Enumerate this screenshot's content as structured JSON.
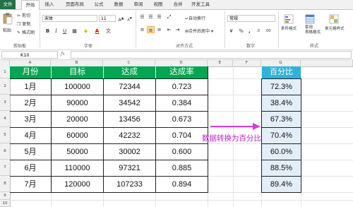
{
  "tabs": [
    "文件",
    "开始",
    "插入",
    "页面布局",
    "公式",
    "数据",
    "审阅",
    "视图",
    "合并",
    "开发工具"
  ],
  "clipboard": {
    "paste": "粘贴",
    "cut": "剪切",
    "copy": "复制",
    "format_painter": "格式刷",
    "label": "剪贴板"
  },
  "font": {
    "name": "宋体",
    "size": "11",
    "label": "字体"
  },
  "alignment": {
    "wrap": "自动换行",
    "merge": "合并后居中",
    "label": "对齐方式"
  },
  "number": {
    "format": "常规",
    "label": "数字",
    "percent": "%",
    "comma": ","
  },
  "styles": {
    "conditional": "条件格式",
    "table": "套用\n表格格式",
    "cell": "单元格样式",
    "label": "样式"
  },
  "namebox": "K10",
  "fx": "fx",
  "columns": [
    "A",
    "B",
    "C",
    "D",
    "E",
    "F",
    "G"
  ],
  "rows": [
    "1",
    "2",
    "3",
    "4",
    "5",
    "6",
    "7",
    "8",
    "9",
    "10"
  ],
  "table_header": [
    "月份",
    "目标",
    "达成",
    "达成率"
  ],
  "table_rows": [
    [
      "1月",
      "100000",
      "72344",
      "0.723"
    ],
    [
      "2月",
      "90000",
      "34542",
      "0.384"
    ],
    [
      "3月",
      "20000",
      "13456",
      "0.673"
    ],
    [
      "4月",
      "60000",
      "42232",
      "0.704"
    ],
    [
      "5月",
      "50000",
      "30002",
      "0.600"
    ],
    [
      "6月",
      "110000",
      "97321",
      "0.885"
    ],
    [
      "7月",
      "120000",
      "107233",
      "0.894"
    ]
  ],
  "pct_header": "百分比",
  "pct_values": [
    "72.3%",
    "38.4%",
    "67.3%",
    "70.4%",
    "60.0%",
    "88.5%",
    "89.4%"
  ],
  "annotation": "数据转换为百分比",
  "colors": {
    "header_green": "#00a651",
    "pct_fill": "#e3eef9",
    "arrow": "#d63fd6",
    "annotation": "#c21fc2"
  }
}
